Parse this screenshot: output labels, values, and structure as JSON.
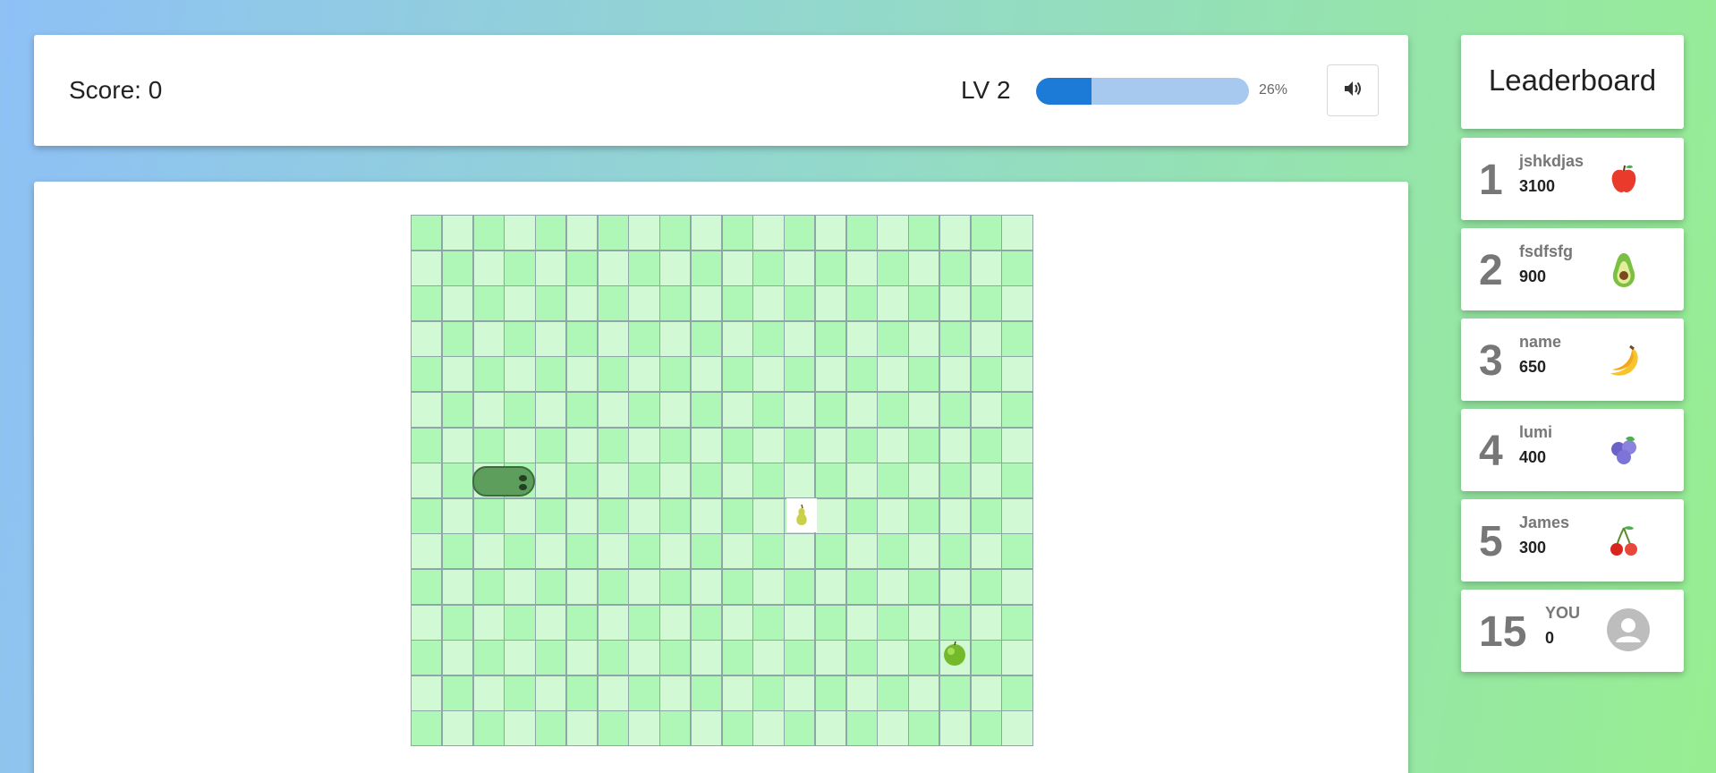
{
  "header": {
    "score_label": "Score: 0",
    "level_label": "LV 2",
    "progress_percent": 26,
    "progress_label": "26%",
    "sound_icon": "volume-icon"
  },
  "game": {
    "grid_columns": 20,
    "grid_rows": 15,
    "snake_icon": "snake-head",
    "items": [
      "pear-icon",
      "apple-icon"
    ]
  },
  "leaderboard": {
    "title": "Leaderboard",
    "entries": [
      {
        "rank": "1",
        "name": "jshkdjas",
        "score": "3100",
        "icon": "apple-icon"
      },
      {
        "rank": "2",
        "name": "fsdfsfg",
        "score": "900",
        "icon": "avocado-icon"
      },
      {
        "rank": "3",
        "name": "name",
        "score": "650",
        "icon": "banana-icon"
      },
      {
        "rank": "4",
        "name": "lumi",
        "score": "400",
        "icon": "blueberry-icon"
      },
      {
        "rank": "5",
        "name": "James",
        "score": "300",
        "icon": "cherry-icon"
      }
    ],
    "you": {
      "rank": "15",
      "name": "YOU",
      "score": "0",
      "icon": "avatar-icon"
    }
  },
  "colors": {
    "cell_dark": "#aef7b6",
    "cell_light": "#d1fad4",
    "progress_fill": "#1c7bd6",
    "progress_track": "#a8c9ef",
    "snake": "#5e9e5c"
  }
}
